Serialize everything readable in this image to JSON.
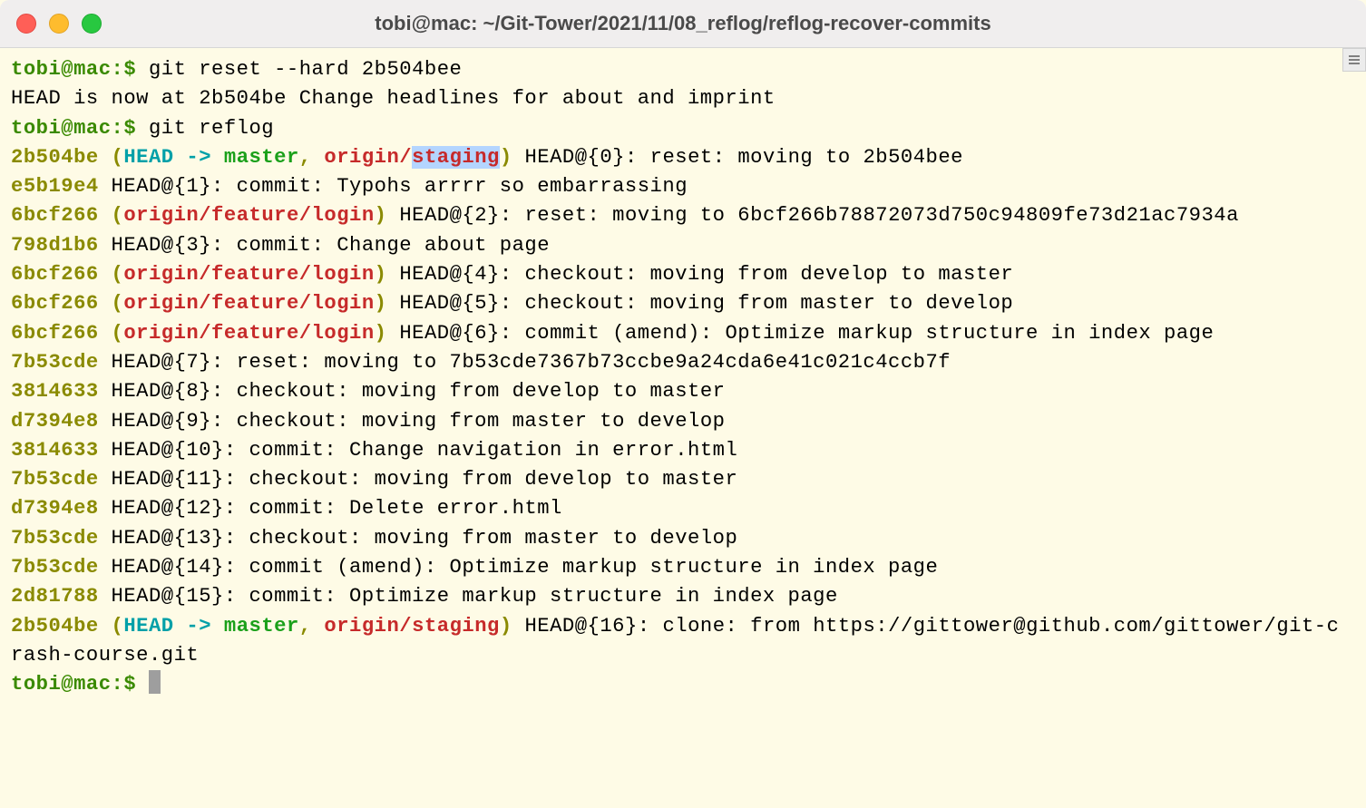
{
  "window": {
    "title": "tobi@mac: ~/Git-Tower/2021/11/08_reflog/reflog-recover-commits"
  },
  "colors": {
    "bg": "#fefbe6",
    "fg": "#000000",
    "prompt_green": "#3a8a00",
    "hash_olive": "#8a8a00",
    "head_cyan": "#00a0a8",
    "branch_green": "#1aa01a",
    "remote_red": "#c62a2a"
  },
  "prompt_string": "tobi@mac:$ ",
  "lines": [
    {
      "type": "cmd",
      "prompt": "tobi@mac:$ ",
      "command": "git reset --hard 2b504bee"
    },
    {
      "type": "plain",
      "text": "HEAD is now at 2b504be Change headlines for about and imprint"
    },
    {
      "type": "cmd",
      "prompt": "tobi@mac:$ ",
      "command": "git reflog"
    },
    {
      "type": "reflog",
      "hash": "2b504be",
      "refs": {
        "head": "HEAD -> ",
        "branch": "master",
        "sep": ", ",
        "remote_prefix": "origin/",
        "remote_name": "staging",
        "selected_part": "staging"
      },
      "index": "HEAD@{0}",
      "message": "reset: moving to 2b504bee"
    },
    {
      "type": "reflog",
      "hash": "e5b19e4",
      "refs": null,
      "index": "HEAD@{1}",
      "message": "commit: Typohs arrrr so embarrassing"
    },
    {
      "type": "reflog",
      "hash": "6bcf266",
      "refs": {
        "remote": "origin/feature/login"
      },
      "index": "HEAD@{2}",
      "message": "reset: moving to 6bcf266b78872073d750c94809fe73d21ac7934a"
    },
    {
      "type": "reflog",
      "hash": "798d1b6",
      "refs": null,
      "index": "HEAD@{3}",
      "message": "commit: Change about page"
    },
    {
      "type": "reflog",
      "hash": "6bcf266",
      "refs": {
        "remote": "origin/feature/login"
      },
      "index": "HEAD@{4}",
      "message": "checkout: moving from develop to master"
    },
    {
      "type": "reflog",
      "hash": "6bcf266",
      "refs": {
        "remote": "origin/feature/login"
      },
      "index": "HEAD@{5}",
      "message": "checkout: moving from master to develop"
    },
    {
      "type": "reflog",
      "hash": "6bcf266",
      "refs": {
        "remote": "origin/feature/login"
      },
      "index": "HEAD@{6}",
      "message": "commit (amend): Optimize markup structure in index page"
    },
    {
      "type": "reflog",
      "hash": "7b53cde",
      "refs": null,
      "index": "HEAD@{7}",
      "message": "reset: moving to 7b53cde7367b73ccbe9a24cda6e41c021c4ccb7f"
    },
    {
      "type": "reflog",
      "hash": "3814633",
      "refs": null,
      "index": "HEAD@{8}",
      "message": "checkout: moving from develop to master"
    },
    {
      "type": "reflog",
      "hash": "d7394e8",
      "refs": null,
      "index": "HEAD@{9}",
      "message": "checkout: moving from master to develop"
    },
    {
      "type": "reflog",
      "hash": "3814633",
      "refs": null,
      "index": "HEAD@{10}",
      "message": "commit: Change navigation in error.html"
    },
    {
      "type": "reflog",
      "hash": "7b53cde",
      "refs": null,
      "index": "HEAD@{11}",
      "message": "checkout: moving from develop to master"
    },
    {
      "type": "reflog",
      "hash": "d7394e8",
      "refs": null,
      "index": "HEAD@{12}",
      "message": "commit: Delete error.html"
    },
    {
      "type": "reflog",
      "hash": "7b53cde",
      "refs": null,
      "index": "HEAD@{13}",
      "message": "checkout: moving from master to develop"
    },
    {
      "type": "reflog",
      "hash": "7b53cde",
      "refs": null,
      "index": "HEAD@{14}",
      "message": "commit (amend): Optimize markup structure in index page"
    },
    {
      "type": "reflog",
      "hash": "2d81788",
      "refs": null,
      "index": "HEAD@{15}",
      "message": "commit: Optimize markup structure in index page"
    },
    {
      "type": "reflog",
      "hash": "2b504be",
      "refs": {
        "head": "HEAD -> ",
        "branch": "master",
        "sep": ", ",
        "remote_prefix": "origin/",
        "remote_name": "staging"
      },
      "index": "HEAD@{16}",
      "message": "clone: from https://gittower@github.com/gittower/git-crash-course.git"
    },
    {
      "type": "cmd",
      "prompt": "tobi@mac:$ ",
      "command": "",
      "cursor": true
    }
  ],
  "icons": {
    "scroll_lines": "scroll-lines-icon"
  }
}
